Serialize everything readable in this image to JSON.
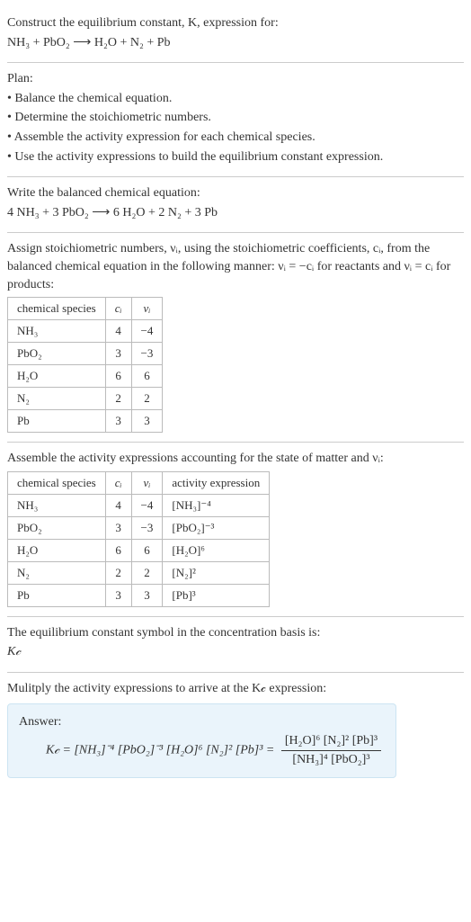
{
  "sec1": {
    "title": "Construct the equilibrium constant, K, expression for:",
    "eqn": "NH₃ + PbO₂ ⟶ H₂O + N₂ + Pb"
  },
  "sec2": {
    "title": "Plan:",
    "b1": "• Balance the chemical equation.",
    "b2": "• Determine the stoichiometric numbers.",
    "b3": "• Assemble the activity expression for each chemical species.",
    "b4": "• Use the activity expressions to build the equilibrium constant expression."
  },
  "sec3": {
    "title": "Write the balanced chemical equation:",
    "eqn": "4 NH₃ + 3 PbO₂ ⟶ 6 H₂O + 2 N₂ + 3 Pb"
  },
  "sec4": {
    "intro1": "Assign stoichiometric numbers, νᵢ, using the stoichiometric coefficients, cᵢ, from the balanced chemical equation in the following manner: νᵢ = −cᵢ for reactants and νᵢ = cᵢ for products:",
    "h_species": "chemical species",
    "h_ci": "cᵢ",
    "h_vi": "νᵢ",
    "r1_s": "NH₃",
    "r1_c": "4",
    "r1_v": "−4",
    "r2_s": "PbO₂",
    "r2_c": "3",
    "r2_v": "−3",
    "r3_s": "H₂O",
    "r3_c": "6",
    "r3_v": "6",
    "r4_s": "N₂",
    "r4_c": "2",
    "r4_v": "2",
    "r5_s": "Pb",
    "r5_c": "3",
    "r5_v": "3"
  },
  "sec5": {
    "intro": "Assemble the activity expressions accounting for the state of matter and νᵢ:",
    "h_species": "chemical species",
    "h_ci": "cᵢ",
    "h_vi": "νᵢ",
    "h_act": "activity expression",
    "r1_s": "NH₃",
    "r1_c": "4",
    "r1_v": "−4",
    "r1_a": "[NH₃]⁻⁴",
    "r2_s": "PbO₂",
    "r2_c": "3",
    "r2_v": "−3",
    "r2_a": "[PbO₂]⁻³",
    "r3_s": "H₂O",
    "r3_c": "6",
    "r3_v": "6",
    "r3_a": "[H₂O]⁶",
    "r4_s": "N₂",
    "r4_c": "2",
    "r4_v": "2",
    "r4_a": "[N₂]²",
    "r5_s": "Pb",
    "r5_c": "3",
    "r5_v": "3",
    "r5_a": "[Pb]³"
  },
  "sec6": {
    "l1": "The equilibrium constant symbol in the concentration basis is:",
    "l2": "K𝒸"
  },
  "sec7": {
    "intro": "Mulitply the activity expressions to arrive at the K𝒸 expression:",
    "answer_label": "Answer:",
    "lhs": "K𝒸 = [NH₃]⁻⁴ [PbO₂]⁻³ [H₂O]⁶ [N₂]² [Pb]³ = ",
    "num": "[H₂O]⁶ [N₂]² [Pb]³",
    "den": "[NH₃]⁴ [PbO₂]³"
  },
  "chart_data": {
    "type": "table",
    "tables": [
      {
        "title": "Stoichiometric numbers",
        "columns": [
          "chemical species",
          "c_i",
          "ν_i"
        ],
        "rows": [
          [
            "NH3",
            4,
            -4
          ],
          [
            "PbO2",
            3,
            -3
          ],
          [
            "H2O",
            6,
            6
          ],
          [
            "N2",
            2,
            2
          ],
          [
            "Pb",
            3,
            3
          ]
        ]
      },
      {
        "title": "Activity expressions",
        "columns": [
          "chemical species",
          "c_i",
          "ν_i",
          "activity expression"
        ],
        "rows": [
          [
            "NH3",
            4,
            -4,
            "[NH3]^-4"
          ],
          [
            "PbO2",
            3,
            -3,
            "[PbO2]^-3"
          ],
          [
            "H2O",
            6,
            6,
            "[H2O]^6"
          ],
          [
            "N2",
            2,
            2,
            "[N2]^2"
          ],
          [
            "Pb",
            3,
            3,
            "[Pb]^3"
          ]
        ]
      }
    ]
  }
}
